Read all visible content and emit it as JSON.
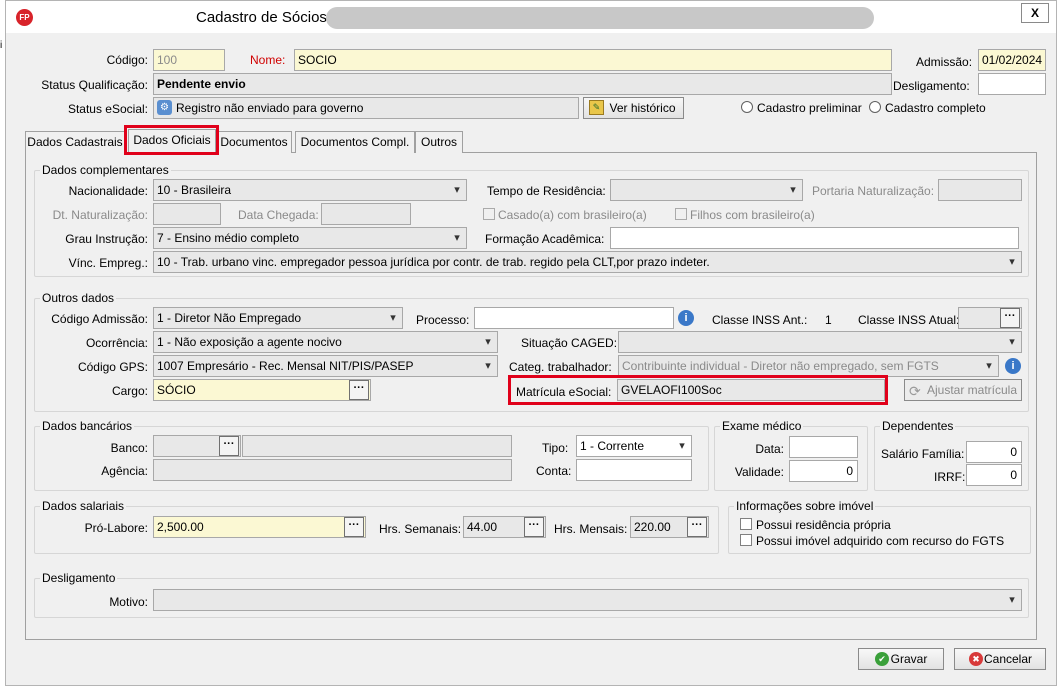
{
  "window": {
    "title": "Cadastro de Sócios",
    "close": "X"
  },
  "header": {
    "codigo_label": "Código:",
    "codigo_value": "100",
    "nome_label": "Nome:",
    "nome_value": "SOCIO",
    "admissao_label": "Admissão:",
    "admissao_value": "01/02/2024",
    "status_qual_label": "Status Qualificação:",
    "status_qual_value": "Pendente envio",
    "desligamento_label": "Desligamento:",
    "desligamento_value": "",
    "status_esocial_label": "Status eSocial:",
    "status_esocial_value": "Registro não enviado para governo",
    "ver_historico": "Ver histórico",
    "cadastro_preliminar": "Cadastro preliminar",
    "cadastro_completo": "Cadastro completo"
  },
  "tabs": [
    "Dados Cadastrais",
    "Dados Oficiais",
    "Documentos",
    "Documentos Compl.",
    "Outros"
  ],
  "dados_complementares": {
    "title": "Dados complementares",
    "nacionalidade_label": "Nacionalidade:",
    "nacionalidade_value": "10  -  Brasileira",
    "tempo_residencia_label": "Tempo de Residência:",
    "tempo_residencia_value": "",
    "portaria_label": "Portaria Naturalização:",
    "portaria_value": "",
    "dt_naturalizacao_label": "Dt. Naturalização:",
    "dt_naturalizacao_value": "",
    "data_chegada_label": "Data Chegada:",
    "data_chegada_value": "",
    "casado_label": "Casado(a) com brasileiro(a)",
    "filhos_label": "Filhos com brasileiro(a)",
    "grau_label": "Grau Instrução:",
    "grau_value": "7  -  Ensino médio completo",
    "formacao_label": "Formação Acadêmica:",
    "formacao_value": "",
    "vinc_label": "Vínc. Empreg.:",
    "vinc_value": "10  -  Trab. urbano vinc.  empregador pessoa jurídica por contr. de trab. regido pela CLT,por prazo indeter."
  },
  "outros_dados": {
    "title": "Outros dados",
    "codigo_admissao_label": "Código Admissão:",
    "codigo_admissao_value": "1 - Diretor Não Empregado",
    "processo_label": "Processo:",
    "processo_value": "",
    "classe_inss_ant_label": "Classe INSS Ant.:",
    "classe_inss_ant_value": "1",
    "classe_inss_atual_label": "Classe INSS Atual:",
    "classe_inss_atual_value": "",
    "ocorrencia_label": "Ocorrência:",
    "ocorrencia_value": "1 - Não exposição a agente nocivo",
    "situacao_caged_label": "Situação CAGED:",
    "situacao_caged_value": "",
    "codigo_gps_label": "Código GPS:",
    "codigo_gps_value": "1007 Empresário - Rec. Mensal NIT/PIS/PASEP",
    "categ_label": "Categ. trabalhador:",
    "categ_value": "Contribuinte individual - Diretor não empregado, sem FGTS",
    "cargo_label": "Cargo:",
    "cargo_value": "SÓCIO",
    "matricula_label": "Matrícula eSocial:",
    "matricula_value": "GVELAOFI100Soc",
    "ajustar_matricula": "Ajustar matrícula"
  },
  "dados_bancarios": {
    "title": "Dados bancários",
    "banco_label": "Banco:",
    "banco_code": "",
    "banco_name": "",
    "agencia_label": "Agência:",
    "agencia_value": "",
    "tipo_label": "Tipo:",
    "tipo_value": "1 - Corrente",
    "conta_label": "Conta:",
    "conta_value": ""
  },
  "exame_medico": {
    "title": "Exame médico",
    "data_label": "Data:",
    "data_value": "",
    "validade_label": "Validade:",
    "validade_value": "0"
  },
  "dependentes": {
    "title": "Dependentes",
    "salario_label": "Salário Família:",
    "salario_value": "0",
    "irrf_label": "IRRF:",
    "irrf_value": "0"
  },
  "dados_salariais": {
    "title": "Dados salariais",
    "pro_labore_label": "Pró-Labore:",
    "pro_labore_value": "2,500.00",
    "hrs_semanais_label": "Hrs. Semanais:",
    "hrs_semanais_value": "44.00",
    "hrs_mensais_label": "Hrs. Mensais:",
    "hrs_mensais_value": "220.00"
  },
  "imovel": {
    "title": "Informações sobre imóvel",
    "residencia_label": "Possui residência própria",
    "fgts_label": "Possui imóvel adquirido com recurso do FGTS"
  },
  "desligamento": {
    "title": "Desligamento",
    "motivo_label": "Motivo:",
    "motivo_value": ""
  },
  "footer": {
    "gravar": "Gravar",
    "cancelar": "Cancelar"
  },
  "colors": {
    "highlight": "#e0001a",
    "required_bg": "#fbf8d3",
    "accent": "#3a78c8"
  }
}
